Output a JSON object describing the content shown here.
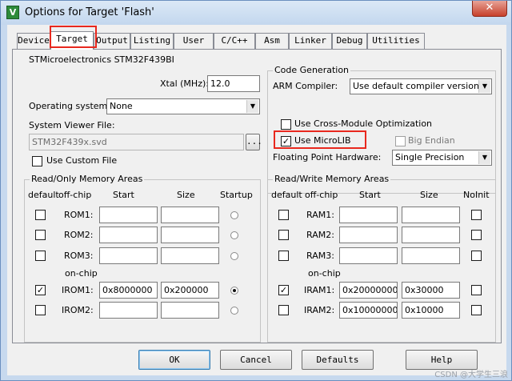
{
  "window": {
    "title": "Options for Target 'Flash'",
    "icon": "keil-uvision-icon",
    "close_label": "✕"
  },
  "tabs": [
    "Device",
    "Target",
    "Output",
    "Listing",
    "User",
    "C/C++",
    "Asm",
    "Linker",
    "Debug",
    "Utilities"
  ],
  "active_tab": "Target",
  "device_name": "STMicroelectronics STM32F439BI",
  "xtal": {
    "label": "Xtal (MHz):",
    "value": "12.0"
  },
  "os": {
    "label": "Operating system:",
    "value": "None"
  },
  "svd": {
    "label": "System Viewer File:",
    "value": "STM32F439x.svd",
    "browse": "...",
    "custom_label": "Use Custom File",
    "custom_checked": false
  },
  "codegen": {
    "title": "Code Generation",
    "compiler_label": "ARM Compiler:",
    "compiler_value": "Use default compiler version 5",
    "cross_module_label": "Use Cross-Module Optimization",
    "cross_module_checked": false,
    "microlib_label": "Use MicroLIB",
    "microlib_checked": true,
    "big_endian_label": "Big Endian",
    "big_endian_checked": false,
    "fpu_label": "Floating Point Hardware:",
    "fpu_value": "Single Precision"
  },
  "rom": {
    "title": "Read/Only Memory Areas",
    "headers": {
      "default": "default",
      "offchip": "off-chip",
      "start": "Start",
      "size": "Size",
      "last": "Startup"
    },
    "onchip_label": "on-chip",
    "rows": [
      {
        "name": "ROM1:",
        "default": false,
        "start": "",
        "size": "",
        "selected": false
      },
      {
        "name": "ROM2:",
        "default": false,
        "start": "",
        "size": "",
        "selected": false
      },
      {
        "name": "ROM3:",
        "default": false,
        "start": "",
        "size": "",
        "selected": false
      },
      {
        "name": "IROM1:",
        "default": true,
        "start": "0x8000000",
        "size": "0x200000",
        "selected": true
      },
      {
        "name": "IROM2:",
        "default": false,
        "start": "",
        "size": "",
        "selected": false
      }
    ]
  },
  "ram": {
    "title": "Read/Write Memory Areas",
    "headers": {
      "default": "default",
      "offchip": "off-chip",
      "start": "Start",
      "size": "Size",
      "last": "NoInit"
    },
    "onchip_label": "on-chip",
    "rows": [
      {
        "name": "RAM1:",
        "default": false,
        "start": "",
        "size": "",
        "noinit": false
      },
      {
        "name": "RAM2:",
        "default": false,
        "start": "",
        "size": "",
        "noinit": false
      },
      {
        "name": "RAM3:",
        "default": false,
        "start": "",
        "size": "",
        "noinit": false
      },
      {
        "name": "IRAM1:",
        "default": true,
        "start": "0x20000000",
        "size": "0x30000",
        "noinit": false
      },
      {
        "name": "IRAM2:",
        "default": false,
        "start": "0x10000000",
        "size": "0x10000",
        "noinit": false
      }
    ]
  },
  "buttons": {
    "ok": "OK",
    "cancel": "Cancel",
    "defaults": "Defaults",
    "help": "Help"
  },
  "watermark": "CSDN @大学生三浪"
}
